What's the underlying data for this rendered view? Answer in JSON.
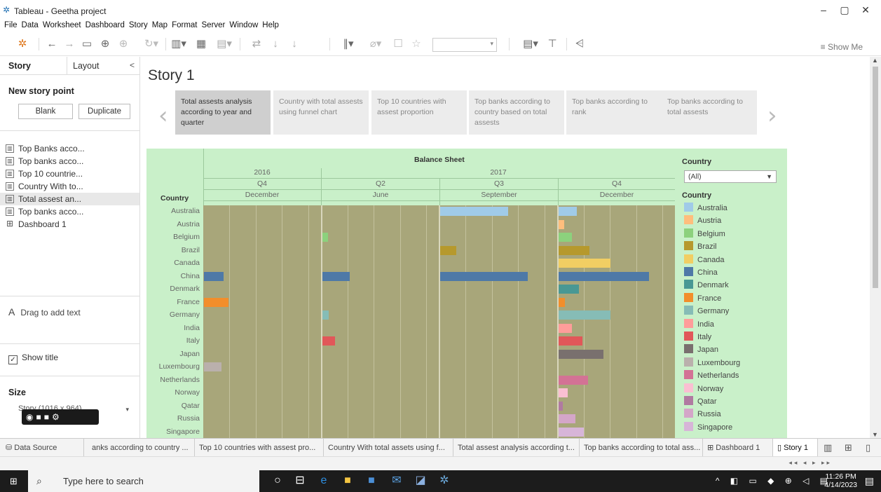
{
  "window": {
    "title": "Tableau - Geetha project",
    "minimize": "–",
    "restore": "▢",
    "close": "✕"
  },
  "menu": [
    "File",
    "Data",
    "Worksheet",
    "Dashboard",
    "Story",
    "Map",
    "Format",
    "Server",
    "Window",
    "Help"
  ],
  "toolbar": {
    "show_me": "Show Me"
  },
  "left_pane": {
    "tab_story": "Story",
    "tab_layout": "Layout",
    "collapse": "<",
    "new_story_point": "New story point",
    "blank_button": "Blank",
    "duplicate_button": "Duplicate",
    "sheets": [
      "Top Banks acco...",
      "Top banks acco...",
      "Top 10 countrie...",
      "Country With to...",
      "Total assest an...",
      "Top banks acco...",
      "Dashboard 1"
    ],
    "drag_text": "Drag to add text",
    "show_title": "Show title",
    "size_label": "Size",
    "size_value": "Story (1016 x 964)"
  },
  "story": {
    "title": "Story 1",
    "points": [
      "Total assests analysis according to year and quarter",
      "Country with total assests using funnel chart",
      "Top 10 countries with assest proportion",
      "Top banks according to country based on total assests",
      "Top banks according to rank",
      "Top banks according to total assests"
    ],
    "prev": "‹",
    "next": "›"
  },
  "chart_data": {
    "type": "bar",
    "title": "Balance Sheet",
    "row_header": "Country",
    "columns": [
      {
        "year": "2016",
        "quarter": "Q4",
        "month": "December"
      },
      {
        "year": "2017",
        "quarter": "Q2",
        "month": "June"
      },
      {
        "year": "2017",
        "quarter": "Q3",
        "month": "September"
      },
      {
        "year": "2017",
        "quarter": "Q4",
        "month": "December"
      }
    ],
    "categories": [
      "Australia",
      "Austria",
      "Belgium",
      "Brazil",
      "Canada",
      "China",
      "Denmark",
      "France",
      "Germany",
      "India",
      "Italy",
      "Japan",
      "Luxembourg",
      "Netherlands",
      "Norway",
      "Qatar",
      "Russia",
      "Singapore"
    ],
    "xlim": [
      0,
      1
    ],
    "series": [
      {
        "name": "2016 Q4 December",
        "values": {
          "China": 0.17,
          "France": 0.21,
          "Luxembourg": 0.15
        }
      },
      {
        "name": "2017 Q2 June",
        "values": {
          "Belgium": 0.05,
          "China": 0.24,
          "Germany": 0.06,
          "Italy": 0.11
        }
      },
      {
        "name": "2017 Q3 September",
        "values": {
          "Australia": 0.59,
          "Brazil": 0.14,
          "China": 0.76
        }
      },
      {
        "name": "2017 Q4 December",
        "values": {
          "Australia": 0.16,
          "Austria": 0.05,
          "Belgium": 0.12,
          "Brazil": 0.27,
          "Canada": 0.45,
          "China": 0.79,
          "Denmark": 0.18,
          "France": 0.06,
          "Germany": 0.45,
          "India": 0.12,
          "Italy": 0.21,
          "Japan": 0.39,
          "Netherlands": 0.26,
          "Norway": 0.08,
          "Qatar": 0.04,
          "Russia": 0.15,
          "Singapore": 0.22
        }
      }
    ],
    "colors": {
      "Australia": "#a0cbe8",
      "Austria": "#ffbe7d",
      "Belgium": "#8cd17d",
      "Brazil": "#b6992d",
      "Canada": "#f1ce63",
      "China": "#4e79a7",
      "Denmark": "#499894",
      "France": "#f28e2b",
      "Germany": "#86bcb6",
      "India": "#ff9d9a",
      "Italy": "#e15759",
      "Japan": "#79706e",
      "Luxembourg": "#bab0ac",
      "Netherlands": "#d37295",
      "Norway": "#fabfd2",
      "Qatar": "#b07aa1",
      "Russia": "#d4a6c8",
      "Singapore": "#d7b5d8"
    },
    "legend": {
      "filter_title": "Country",
      "filter_value": "(All)",
      "title": "Country",
      "placement": "right"
    }
  },
  "sheet_tabs": {
    "data_source": "Data Source",
    "tabs": [
      "anks according to country ...",
      "Top 10 countries with assest pro...",
      "Country With total assets using f...",
      "Total assest analysis according t...",
      "Top banks according to total ass...",
      "Dashboard 1",
      "Story 1"
    ]
  },
  "taskbar": {
    "search_placeholder": "Type here to search",
    "time": "11:26 PM",
    "date": "4/14/2023"
  }
}
